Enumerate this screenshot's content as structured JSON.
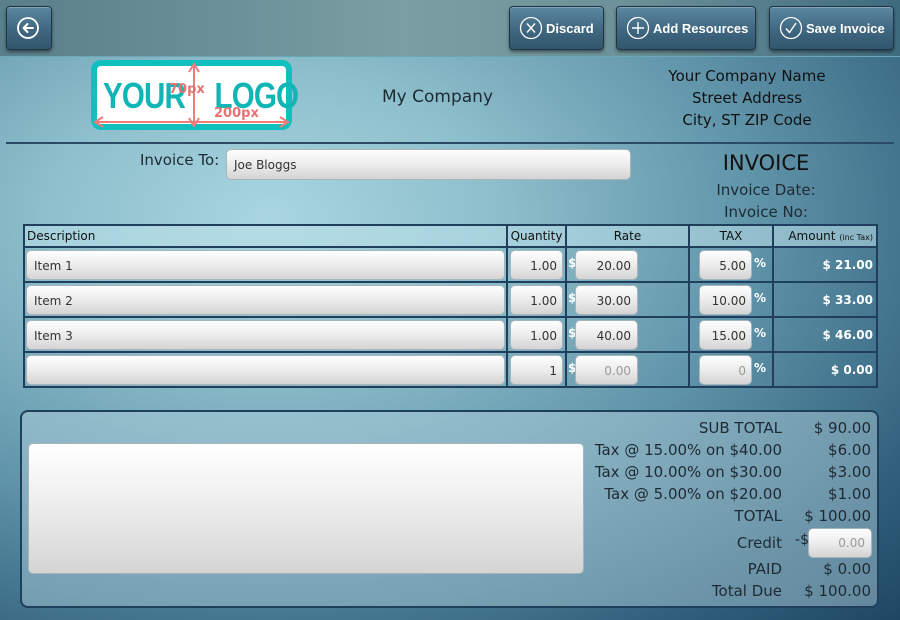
{
  "toolbar": {
    "back_icon": "arrow-left-circle-icon",
    "discard": {
      "label": "Discard",
      "icon": "x-circle-icon"
    },
    "add_resources": {
      "label": "Add Resources",
      "icon": "plus-circle-icon"
    },
    "save_invoice": {
      "label": "Save Invoice",
      "icon": "check-circle-icon"
    }
  },
  "header": {
    "logo": {
      "line1": "YOUR",
      "line2": "LOGO",
      "height_note": "70px",
      "width_note": "200px"
    },
    "company_short": "My Company",
    "company_name": "Your Company Name",
    "street": "Street Address",
    "city": "City, ST ZIP Code"
  },
  "invoice": {
    "to_label": "Invoice To:",
    "to_value": "Joe Bloggs",
    "title": "INVOICE",
    "date_label": "Invoice Date:",
    "no_label": "Invoice No:"
  },
  "table": {
    "headers": {
      "description": "Description",
      "quantity": "Quantity",
      "rate": "Rate",
      "tax": "TAX",
      "amount": "Amount",
      "amount_note": "(inc Tax)"
    },
    "currency": "$",
    "percent": "%",
    "rows": [
      {
        "description": "Item 1",
        "quantity": "1.00",
        "rate": "20.00",
        "tax": "5.00",
        "amount": "$ 21.00"
      },
      {
        "description": "Item 2",
        "quantity": "1.00",
        "rate": "30.00",
        "tax": "10.00",
        "amount": "$ 33.00"
      },
      {
        "description": "Item 3",
        "quantity": "1.00",
        "rate": "40.00",
        "tax": "15.00",
        "amount": "$ 46.00"
      },
      {
        "description": "",
        "quantity": "1",
        "rate": "0.00",
        "tax": "0",
        "amount": "$ 0.00"
      }
    ]
  },
  "summary": {
    "notes_value": "",
    "subtotal_label": "SUB TOTAL",
    "subtotal": "$ 90.00",
    "tax_lines": [
      {
        "label": "Tax @ 15.00% on $40.00",
        "value": "$6.00"
      },
      {
        "label": "Tax @ 10.00% on $30.00",
        "value": "$3.00"
      },
      {
        "label": "Tax @ 5.00% on $20.00",
        "value": "$1.00"
      }
    ],
    "total_label": "TOTAL",
    "total": "$ 100.00",
    "credit_label": "Credit",
    "credit_prefix": "-$",
    "credit_placeholder": "0.00",
    "paid_label": "PAID",
    "paid": "$ 0.00",
    "due_label": "Total Due",
    "due": "$ 100.00"
  }
}
